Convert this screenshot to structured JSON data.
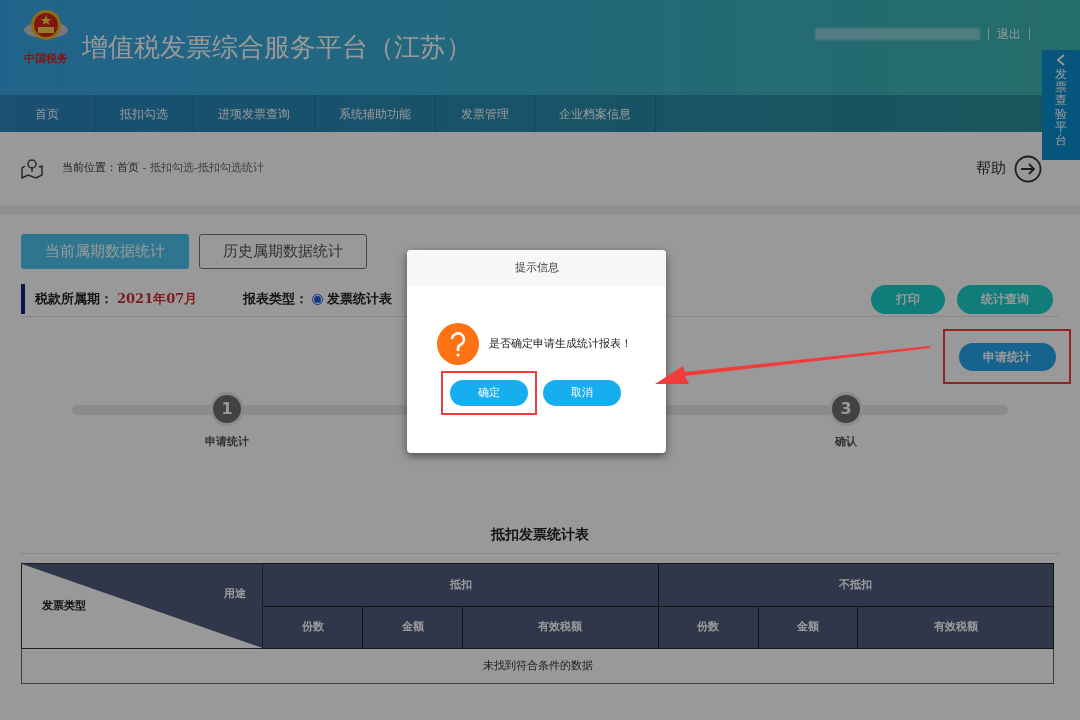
{
  "header": {
    "logo_caption": "中国税务",
    "title": "增值税发票综合服务平台（江苏）",
    "user_links": [
      {
        "label": "退出"
      }
    ]
  },
  "nav": [
    {
      "label": "首页",
      "selected": false
    },
    {
      "label": "抵扣勾选",
      "selected": false
    },
    {
      "label": "进项发票查询",
      "selected": false
    },
    {
      "label": "系统辅助功能",
      "selected": false
    },
    {
      "label": "发票管理",
      "selected": false
    },
    {
      "label": "企业档案信息",
      "selected": false
    }
  ],
  "side_tab": {
    "label": "发票查验平台"
  },
  "breadcrumb": {
    "prefix": "当前位置：",
    "home": "首页",
    "separator": " - ",
    "path": "抵扣勾选-抵扣勾选统计",
    "help": "帮助"
  },
  "tabs": [
    {
      "label": "当前属期数据统计",
      "selected": true
    },
    {
      "label": "历史属期数据统计",
      "selected": false
    }
  ],
  "filters": {
    "period_label": "税款所属期：",
    "period_value": "2021年07月",
    "report_label": "报表类型：",
    "report_options": [
      {
        "label": "发票统计表",
        "selected": true
      }
    ]
  },
  "actions": [
    "打印",
    "统计查询"
  ],
  "apply_button": "申请统计",
  "steps": [
    {
      "number": "1",
      "label": "申请统计"
    },
    {
      "number": "3",
      "label": "确认"
    }
  ],
  "table": {
    "title": "抵扣发票统计表",
    "corner_row": "发票类型",
    "corner_column": "用途",
    "groups": [
      "抵扣",
      "不抵扣"
    ],
    "columns": [
      "份数",
      "金额",
      "有效税额",
      "份数",
      "金额",
      "有效税额"
    ],
    "empty_message": "未找到符合条件的数据"
  },
  "dialog": {
    "title": "提示信息",
    "message": "是否确定申请生成统计报表！",
    "buttons": [
      "确定",
      "取消"
    ]
  }
}
